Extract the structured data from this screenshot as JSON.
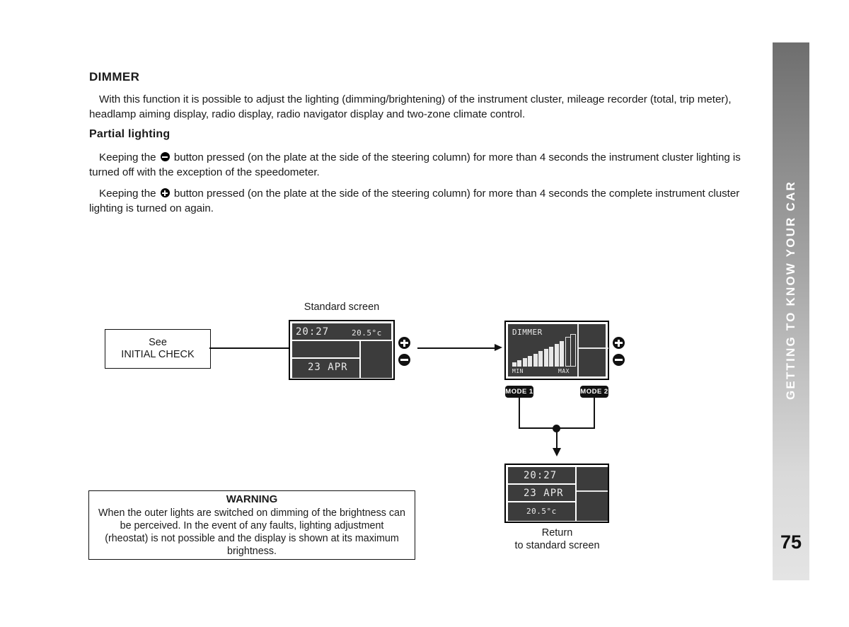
{
  "section_tab": {
    "label": "GETTING TO KNOW YOUR CAR",
    "page_number": "75",
    "gradient_from": "#6e6e6e",
    "gradient_to": "#e4e4e4"
  },
  "content": {
    "title": "DIMMER",
    "intro": "With this function it is possible to adjust the lighting (dimming/brightening) of the instrument cluster, mileage recorder (total, trip meter), headlamp aiming display, radio display, radio navigator display and two-zone climate control.",
    "subtitle": "Partial lighting",
    "paragraph_minus_before": "Keeping the ",
    "paragraph_minus_after": " button pressed (on the plate at the side of the steering column) for more than 4 seconds the instrument cluster lighting is turned off with the exception of the speedometer.",
    "paragraph_plus_before": "Keeping the ",
    "paragraph_plus_after": " button pressed (on the plate at the side of the steering column) for more than 4 seconds the complete instrument cluster lighting is turned on again."
  },
  "diagram": {
    "initial_check_box": {
      "line1": "See",
      "line2": "INITIAL CHECK"
    },
    "standard_screen_label": "Standard screen",
    "standard_screen": {
      "time": "20:27",
      "temperature": "20.5°c",
      "date": "23 APR"
    },
    "dimmer_screen": {
      "title": "DIMMER",
      "min_label": "MIN",
      "max_label": "MAX",
      "bar_levels": [
        8,
        11,
        15,
        19,
        23,
        27,
        31,
        35,
        40,
        45,
        50,
        55
      ],
      "filled_count": 10,
      "hollow_count": 2
    },
    "mode_buttons": [
      {
        "label": "MODE 1"
      },
      {
        "label": "MODE 2"
      }
    ],
    "return_screen": {
      "time": "20:27",
      "date": "23 APR",
      "temperature": "20.5°c"
    },
    "return_caption": {
      "line1": "Return",
      "line2": "to standard screen"
    }
  },
  "warning": {
    "title": "WARNING",
    "text": "When the outer lights are switched on dimming of the brightness can be perceived. In the event of any faults, lighting adjustment (rheostat) is not possible and the display is shown at its maximum brightness."
  }
}
